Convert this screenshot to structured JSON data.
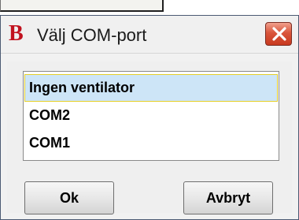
{
  "window": {
    "title": "Välj COM-port",
    "logo_letter": "B",
    "logo_color": "#c1121f",
    "close_icon": "close-icon"
  },
  "list": {
    "items": [
      {
        "label": "Ingen ventilator",
        "selected": true
      },
      {
        "label": "COM2",
        "selected": false
      },
      {
        "label": "COM1",
        "selected": false
      }
    ],
    "selection_color": "#cde5f7",
    "focus_color": "#e7cf28"
  },
  "buttons": {
    "ok_label": "Ok",
    "cancel_label": "Avbryt"
  }
}
